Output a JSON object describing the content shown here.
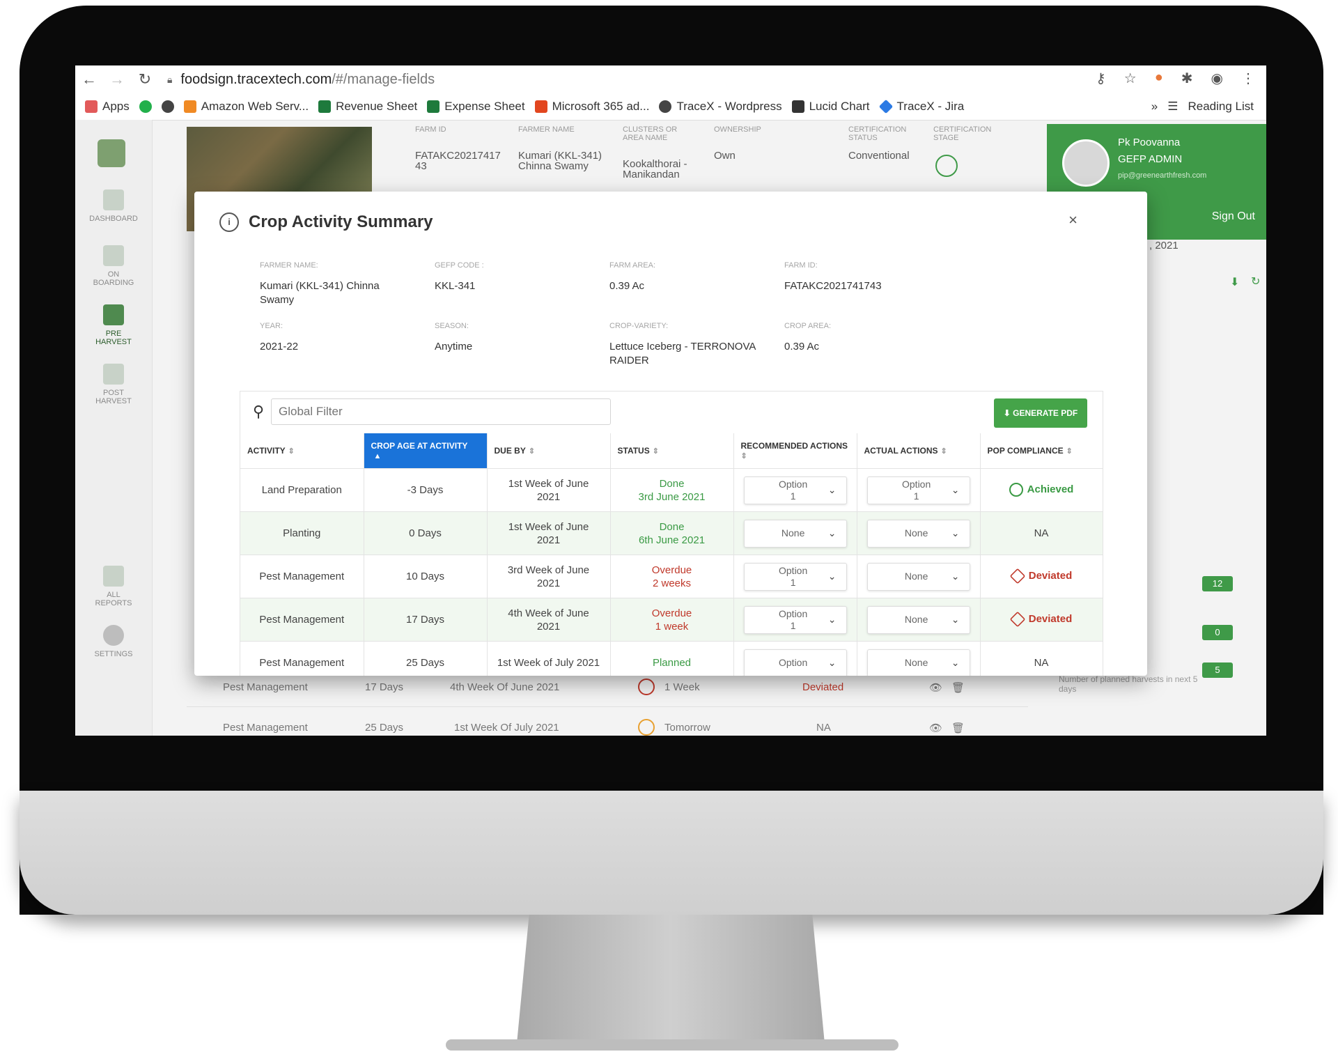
{
  "browser": {
    "url_host": "foodsign.tracextech.com",
    "url_path": "/#/manage-fields",
    "bookmarks": [
      "Apps",
      "Amazon Web Serv...",
      "Revenue Sheet",
      "Expense Sheet",
      "Microsoft 365 ad...",
      "TraceX - Wordpress",
      "Lucid Chart",
      "TraceX - Jira"
    ],
    "reading_list": "Reading List",
    "more": "»"
  },
  "sidebar": {
    "items": [
      "DASHBOARD",
      "ON BOARDING",
      "PRE HARVEST",
      "POST HARVEST",
      "ALL REPORTS",
      "SETTINGS"
    ]
  },
  "farm_header": {
    "labels": [
      "FARM ID",
      "FARMER NAME",
      "CLUSTERS OR AREA NAME",
      "OWNERSHIP",
      "CERTIFICATION STATUS",
      "CERTIFICATION STAGE"
    ],
    "values": [
      "FATAKC20217417 43",
      "Kumari (KKL-341) Chinna Swamy",
      "Kookalthorai - Manikandan",
      "Own",
      "Conventional"
    ]
  },
  "user": {
    "name": "Pk Poovanna",
    "role": "GEFP ADMIN",
    "email": "pip@greenearthfresh.com",
    "sign_out": "Sign Out"
  },
  "right_panel": {
    "date": ", 2021",
    "metrics": [
      "12",
      "0",
      "5"
    ],
    "metric_label": "Number of planned harvests in next 5 days"
  },
  "background_rows": [
    {
      "activity": "Pest Management",
      "age": "17 Days",
      "due": "4th Week Of June 2021",
      "when": "1 Week",
      "compliance": "Deviated"
    },
    {
      "activity": "Pest Management",
      "age": "25 Days",
      "due": "1st Week Of July 2021",
      "when": "Tomorrow",
      "compliance": "NA"
    }
  ],
  "modal": {
    "title": "Crop Activity Summary",
    "close": "×",
    "details": [
      {
        "label": "FARMER NAME:",
        "value": "Kumari (KKL-341) Chinna Swamy"
      },
      {
        "label": "GEFP CODE :",
        "value": "KKL-341"
      },
      {
        "label": "FARM AREA:",
        "value": "0.39 Ac"
      },
      {
        "label": "FARM ID:",
        "value": "FATAKC2021741743"
      },
      {
        "label": "YEAR:",
        "value": "2021-22"
      },
      {
        "label": "SEASON:",
        "value": "Anytime"
      },
      {
        "label": "CROP-VARIETY:",
        "value": "Lettuce Iceberg - TERRONOVA RAIDER"
      },
      {
        "label": "CROP AREA:",
        "value": "0.39 Ac"
      }
    ],
    "filter_placeholder": "Global Filter",
    "generate_pdf": "⬇ GENERATE PDF",
    "columns": [
      "ACTIVITY",
      "CROP AGE AT ACTIVITY",
      "DUE BY",
      "STATUS",
      "RECOMMENDED ACTIONS",
      "ACTUAL ACTIONS",
      "POP COMPLIANCE"
    ],
    "rows": [
      {
        "activity": "Land Preparation",
        "age": "-3 Days",
        "due": "1st Week of June 2021",
        "status": "Done",
        "status_detail": "3rd June 2021",
        "status_type": "done",
        "recommended": "Option\n1",
        "actual": "Option\n1",
        "compliance": "Achieved"
      },
      {
        "activity": "Planting",
        "age": "0 Days",
        "due": "1st Week of June 2021",
        "status": "Done",
        "status_detail": "6th June 2021",
        "status_type": "done",
        "recommended": "None",
        "actual": "None",
        "compliance": "NA"
      },
      {
        "activity": "Pest Management",
        "age": "10 Days",
        "due": "3rd Week of June 2021",
        "status": "Overdue",
        "status_detail": "2 weeks",
        "status_type": "overdue",
        "recommended": "Option\n1",
        "actual": "None",
        "compliance": "Deviated"
      },
      {
        "activity": "Pest Management",
        "age": "17 Days",
        "due": "4th Week of June 2021",
        "status": "Overdue",
        "status_detail": "1 week",
        "status_type": "overdue",
        "recommended": "Option\n1",
        "actual": "None",
        "compliance": "Deviated"
      },
      {
        "activity": "Pest Management",
        "age": "25 Days",
        "due": "1st Week of July 2021",
        "status": "Planned",
        "status_detail": "",
        "status_type": "done",
        "recommended": "Option",
        "actual": "None",
        "compliance": "NA"
      }
    ]
  },
  "colors": {
    "accent_green": "#3f9a48",
    "sorted_header_blue": "#1a73d9",
    "deviated_red": "#c0392b"
  }
}
